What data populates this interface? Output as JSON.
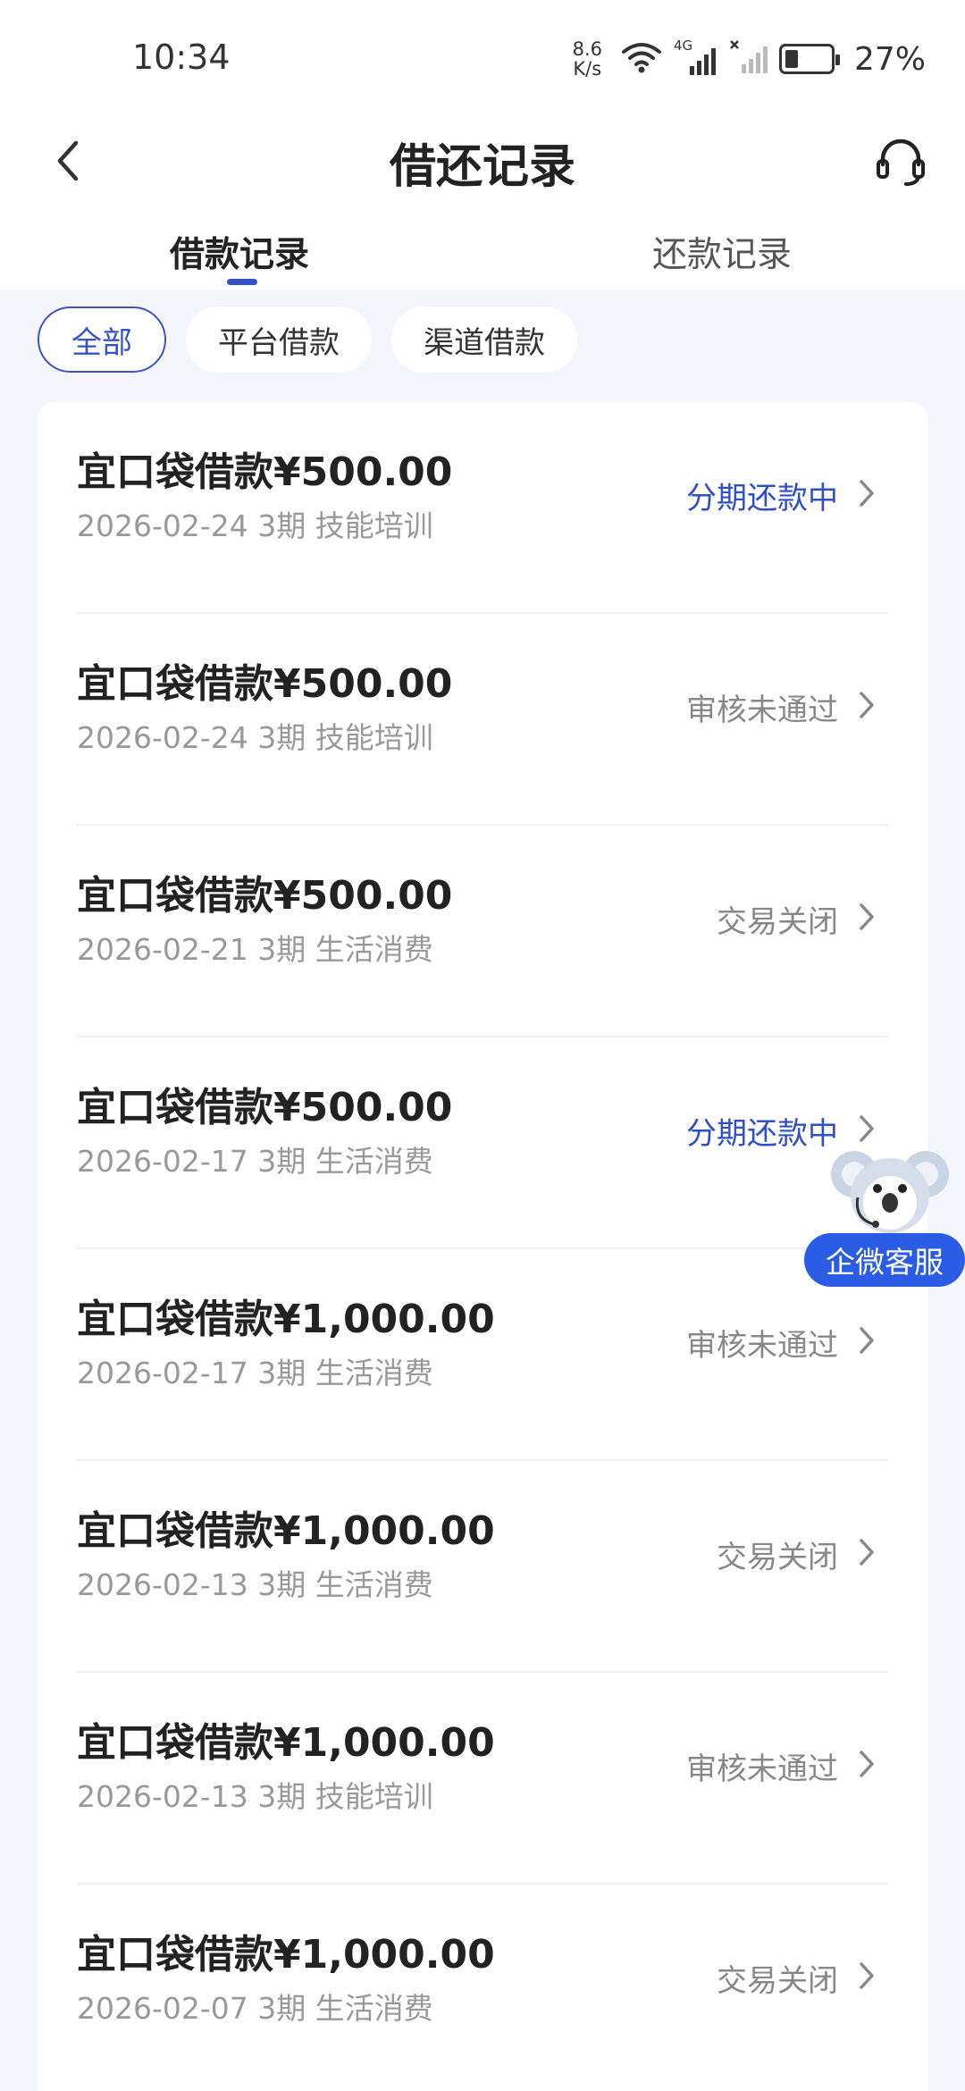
{
  "status_bar": {
    "time": "10:34",
    "net_speed_value": "8.6",
    "net_speed_unit": "K/s",
    "network_type": "4G",
    "battery_percent": "27%",
    "battery_level": 0.27
  },
  "header": {
    "title": "借还记录"
  },
  "tabs": {
    "borrow": "借款记录",
    "repay": "还款记录",
    "active": "borrow"
  },
  "filters": [
    {
      "label": "全部",
      "active": true
    },
    {
      "label": "平台借款",
      "active": false
    },
    {
      "label": "渠道借款",
      "active": false
    }
  ],
  "records": [
    {
      "title": "宜口袋借款¥500.00",
      "subtitle": "2026-02-24 3期  技能培训",
      "status": "分期还款中",
      "status_color": "#2f4fc7"
    },
    {
      "title": "宜口袋借款¥500.00",
      "subtitle": "2026-02-24 3期  技能培训",
      "status": "审核未通过",
      "status_color": "#888888"
    },
    {
      "title": "宜口袋借款¥500.00",
      "subtitle": "2026-02-21 3期  生活消费",
      "status": "交易关闭",
      "status_color": "#888888"
    },
    {
      "title": "宜口袋借款¥500.00",
      "subtitle": "2026-02-17 3期  生活消费",
      "status": "分期还款中",
      "status_color": "#2f4fc7"
    },
    {
      "title": "宜口袋借款¥1,000.00",
      "subtitle": "2026-02-17 3期  生活消费",
      "status": "审核未通过",
      "status_color": "#888888"
    },
    {
      "title": "宜口袋借款¥1,000.00",
      "subtitle": "2026-02-13 3期  生活消费",
      "status": "交易关闭",
      "status_color": "#888888"
    },
    {
      "title": "宜口袋借款¥1,000.00",
      "subtitle": "2026-02-13 3期  技能培训",
      "status": "审核未通过",
      "status_color": "#888888"
    },
    {
      "title": "宜口袋借款¥1,000.00",
      "subtitle": "2026-02-07 3期  生活消费",
      "status": "交易关闭",
      "status_color": "#888888"
    }
  ],
  "float_service": {
    "label": "企微客服"
  },
  "colors": {
    "accent": "#3553c8",
    "float_button": "#2b5ce6"
  }
}
